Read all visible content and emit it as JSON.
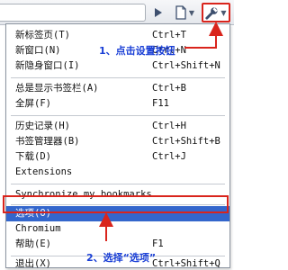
{
  "menu": {
    "items": [
      {
        "label": "新标签页(T)",
        "shortcut": "Ctrl+T"
      },
      {
        "label": "新窗口(N)",
        "shortcut": "Ctrl+N"
      },
      {
        "label": "新隐身窗口(I)",
        "shortcut": "Ctrl+Shift+N"
      },
      {
        "label": "总是显示书签栏(A)",
        "shortcut": "Ctrl+B"
      },
      {
        "label": "全屏(F)",
        "shortcut": "F11"
      },
      {
        "label": "历史记录(H)",
        "shortcut": "Ctrl+H"
      },
      {
        "label": "书签管理器(B)",
        "shortcut": "Ctrl+Shift+B"
      },
      {
        "label": "下载(D)",
        "shortcut": "Ctrl+J"
      },
      {
        "label": "Extensions",
        "shortcut": ""
      },
      {
        "label": "Synchronize my bookmarks...",
        "shortcut": ""
      },
      {
        "label": "选项(O)",
        "shortcut": ""
      },
      {
        "label": "Chromium",
        "shortcut": ""
      },
      {
        "label": "帮助(E)",
        "shortcut": "F1"
      },
      {
        "label": "退出(X)",
        "shortcut": "Ctrl+Shift+Q"
      }
    ]
  },
  "annotations": {
    "step1": "1、点击设置按钮",
    "step2": "2、选择“选项”"
  },
  "toolbar": {
    "icons": [
      "play-icon",
      "page-icon",
      "wrench-icon"
    ]
  },
  "colors": {
    "annotation": "#1a3fd6",
    "highlight_border": "#d9241c",
    "selected_bg": "#3366cc"
  }
}
